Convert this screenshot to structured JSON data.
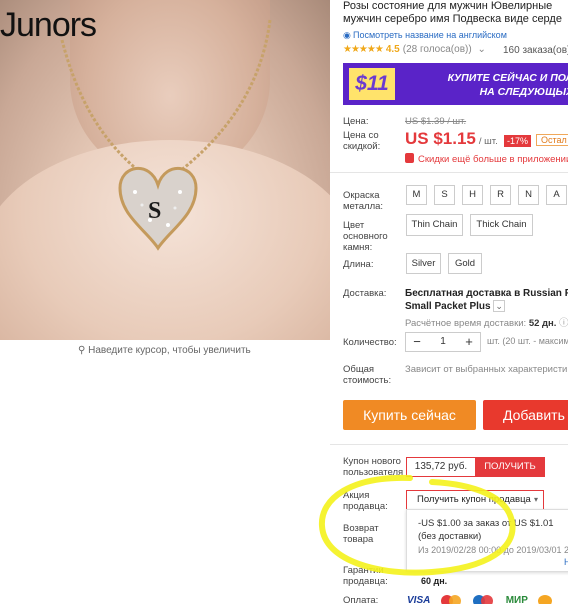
{
  "image": {
    "brand_text": "Junors",
    "caption": "Наведите курсор, чтобы увеличить",
    "pendant_letter": "S"
  },
  "product": {
    "title_line1": "Розы состояние для мужчин Ювелирные",
    "title_line2": "мужчин серебро имя Подвеска виде серде",
    "translate_link": "Посмотреть название на английском",
    "rating_stars": "★★★★★",
    "rating_value": "4.5",
    "votes": "(28 голоса(ов))",
    "orders": "160 заказа(ов)"
  },
  "banner": {
    "coin": "$11",
    "line1": "КУПИТЕ СЕЙЧАС И ПОЛ",
    "line2": "НА СЛЕДУЮЩЫХ"
  },
  "price": {
    "label_price": "Цена:",
    "old": "US $1.39 / шт.",
    "label_discount_line1": "Цена со",
    "label_discount_line2": "скидкой:",
    "now": "US $1.15",
    "per": "/ шт.",
    "discount": "-17%",
    "rest": "Остал",
    "app_discount": "Скидки ещё больше в приложении"
  },
  "options": {
    "metal_label_line1": "Окраска",
    "metal_label_line2": "металла:",
    "metal_values": [
      "M",
      "S",
      "H",
      "R",
      "N",
      "A"
    ],
    "stone_label_line1": "Цвет",
    "stone_label_line2": "основного",
    "stone_label_line3": "камня:",
    "stone_values": [
      "Thin Chain",
      "Thick Chain"
    ],
    "length_label": "Длина:",
    "length_values": [
      "Silver",
      "Gold"
    ]
  },
  "shipping": {
    "label": "Доставка:",
    "title_line1": "Бесплатная доставка в Russian Fede",
    "title_line2": "Small Packet Plus",
    "time_label": "Расчётное время доставки:",
    "time_value": "52 дн."
  },
  "quantity": {
    "label": "Количество:",
    "minus": "−",
    "value": "1",
    "plus": "+",
    "note": "шт. (20 шт. - максим"
  },
  "total": {
    "label_line1": "Общая",
    "label_line2": "стоимость:",
    "note": "Зависит от выбранных характеристи"
  },
  "actions": {
    "buy_now": "Купить сейчас",
    "add_to_cart": "Добавить в"
  },
  "coupon": {
    "label_line1": "Купон нового",
    "label_line2": "пользователя",
    "amount": "135,72 руб.",
    "get": "ПОЛУЧИТЬ"
  },
  "seller_promo": {
    "label_line1": "Акция",
    "label_line2": "продавца:",
    "dropdown": "Получить купон продавца",
    "popup_line1": "-US $1.00 за заказ от US $1.01",
    "popup_line2": "(без доставки)",
    "popup_line3": "Из 2019/02/28 00:00 до 2019/03/01 2",
    "popup_more": "Н"
  },
  "return": {
    "label_line1": "Возврат",
    "label_line2": "товара"
  },
  "guarantee": {
    "label_line1": "Гарантии",
    "label_line2": "продавца:",
    "value": "60 дн."
  },
  "payment": {
    "label": "Оплата:",
    "visa": "VISA",
    "mir": "МИР"
  },
  "colors": {
    "accent_red": "#e4393c",
    "buy_orange": "#f08a24",
    "banner_purple": "#5a23c8",
    "highlight_yellow": "#f4f21c"
  }
}
